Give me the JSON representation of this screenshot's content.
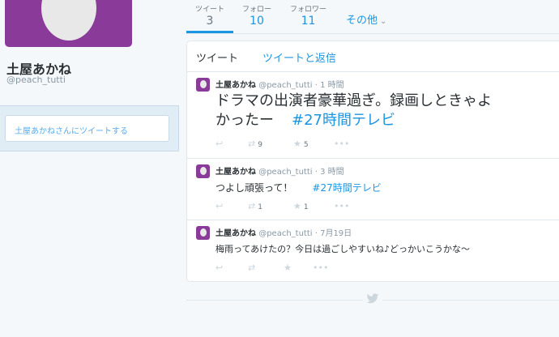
{
  "profile": {
    "name": "土屋あかね",
    "handle": "@peach_tutti",
    "tweet_to_placeholder": "土屋あかねさんにツイートする"
  },
  "stats": [
    {
      "label": "ツイート",
      "value": "3"
    },
    {
      "label": "フォロー",
      "value": "10"
    },
    {
      "label": "フォロワー",
      "value": "11"
    }
  ],
  "more_label": "その他",
  "timeline_tabs": {
    "tweets": "ツイート",
    "tweets_replies": "ツイートと返信"
  },
  "tweets": [
    {
      "name": "土屋あかね",
      "handle": "@peach_tutti",
      "time": "· 1 時間",
      "text_line1": "ドラマの出演者豪華過ぎ。録画しときゃよ",
      "text_line2": "かったー",
      "hashtag": "#27時間テレビ",
      "retweets": "9",
      "favorites": "5"
    },
    {
      "name": "土屋あかね",
      "handle": "@peach_tutti",
      "time": "· 3 時間",
      "text": "つよし頑張って！",
      "hashtag": "#27時間テレビ",
      "retweets": "1",
      "favorites": "1"
    },
    {
      "name": "土屋あかね",
      "handle": "@peach_tutti",
      "time": "· 7月19日",
      "text": "梅雨ってあけたの？今日は過ごしやすいね♪どっかいこうかな～"
    }
  ],
  "icons": {
    "reply": "↩",
    "retweet": "⇄",
    "favorite": "★",
    "more": "•••",
    "chevron": "⌄",
    "bird": "twitter-bird-icon"
  },
  "colors": {
    "accent": "#1b95e0",
    "avatar_bg": "#8a3a98"
  }
}
